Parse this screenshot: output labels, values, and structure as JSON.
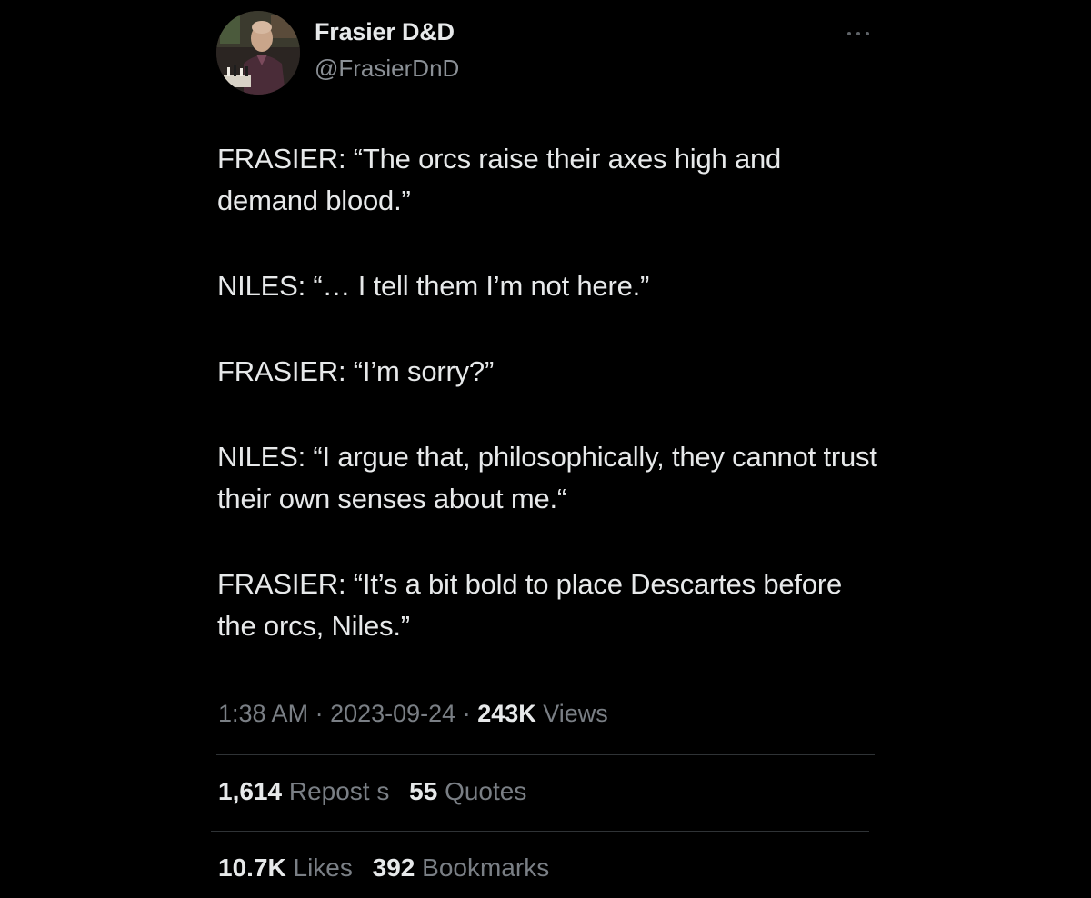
{
  "author": {
    "display_name": "Frasier D&D",
    "handle": "@FrasierDnD",
    "avatar_icon": "profile-photo-man-with-chessboard"
  },
  "more_icon": "more-horizontal-icon",
  "tweet": {
    "paragraphs": [
      "FRASIER: “The orcs raise their axes high and demand blood.”",
      "NILES: “… I tell them I’m not here.”",
      "FRASIER: “I’m sorry?”",
      "NILES: “I argue that, philosophically, they cannot trust their own senses about me.“",
      "FRASIER: “It’s a bit bold to place Descartes before the orcs, Niles.”"
    ]
  },
  "meta": {
    "time": "1:38 AM",
    "separator": " · ",
    "date": "2023-09-24",
    "views_count": "243K",
    "views_label": "Views"
  },
  "stats": {
    "reposts_count": "1,614",
    "reposts_label": "Repost s",
    "quotes_count": "55",
    "quotes_label": "Quotes",
    "likes_count": "10.7K",
    "likes_label": "Likes",
    "bookmarks_count": "392",
    "bookmarks_label": "Bookmarks"
  },
  "colors": {
    "background": "#000000",
    "primary_text": "#e7e9ea",
    "secondary_text": "#7a7f85",
    "divider": "#2f3336"
  }
}
